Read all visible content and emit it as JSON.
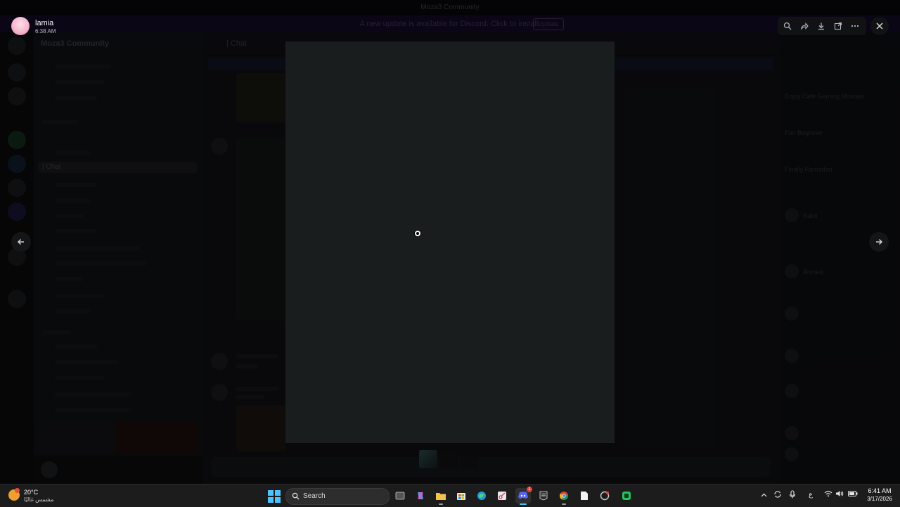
{
  "window": {
    "title": "Moza3 Community"
  },
  "banner": {
    "text": "A new update is available for Discord. Click to install.",
    "button": "Update"
  },
  "server": {
    "name": "Moza3 Community"
  },
  "channel": {
    "name": "| Chat"
  },
  "members": {
    "items": [
      "Enjoy Café Gaming Mosque",
      "Fun Beginner",
      "Finally Ramadan",
      "Nabil",
      "Ahmed"
    ]
  },
  "viewer": {
    "author_name": "lamia",
    "author_time": "6:38 AM",
    "toolbar_icons": [
      "zoom-icon",
      "forward-icon",
      "download-icon",
      "open-external-icon",
      "more-icon"
    ]
  },
  "taskbar": {
    "weather_temp": "20°C",
    "weather_desc": "مشمس غالبًا",
    "search_label": "Search",
    "lang": "ع",
    "time": "6:41 AM",
    "date": "3/17/2026",
    "discord_badge": "1"
  }
}
